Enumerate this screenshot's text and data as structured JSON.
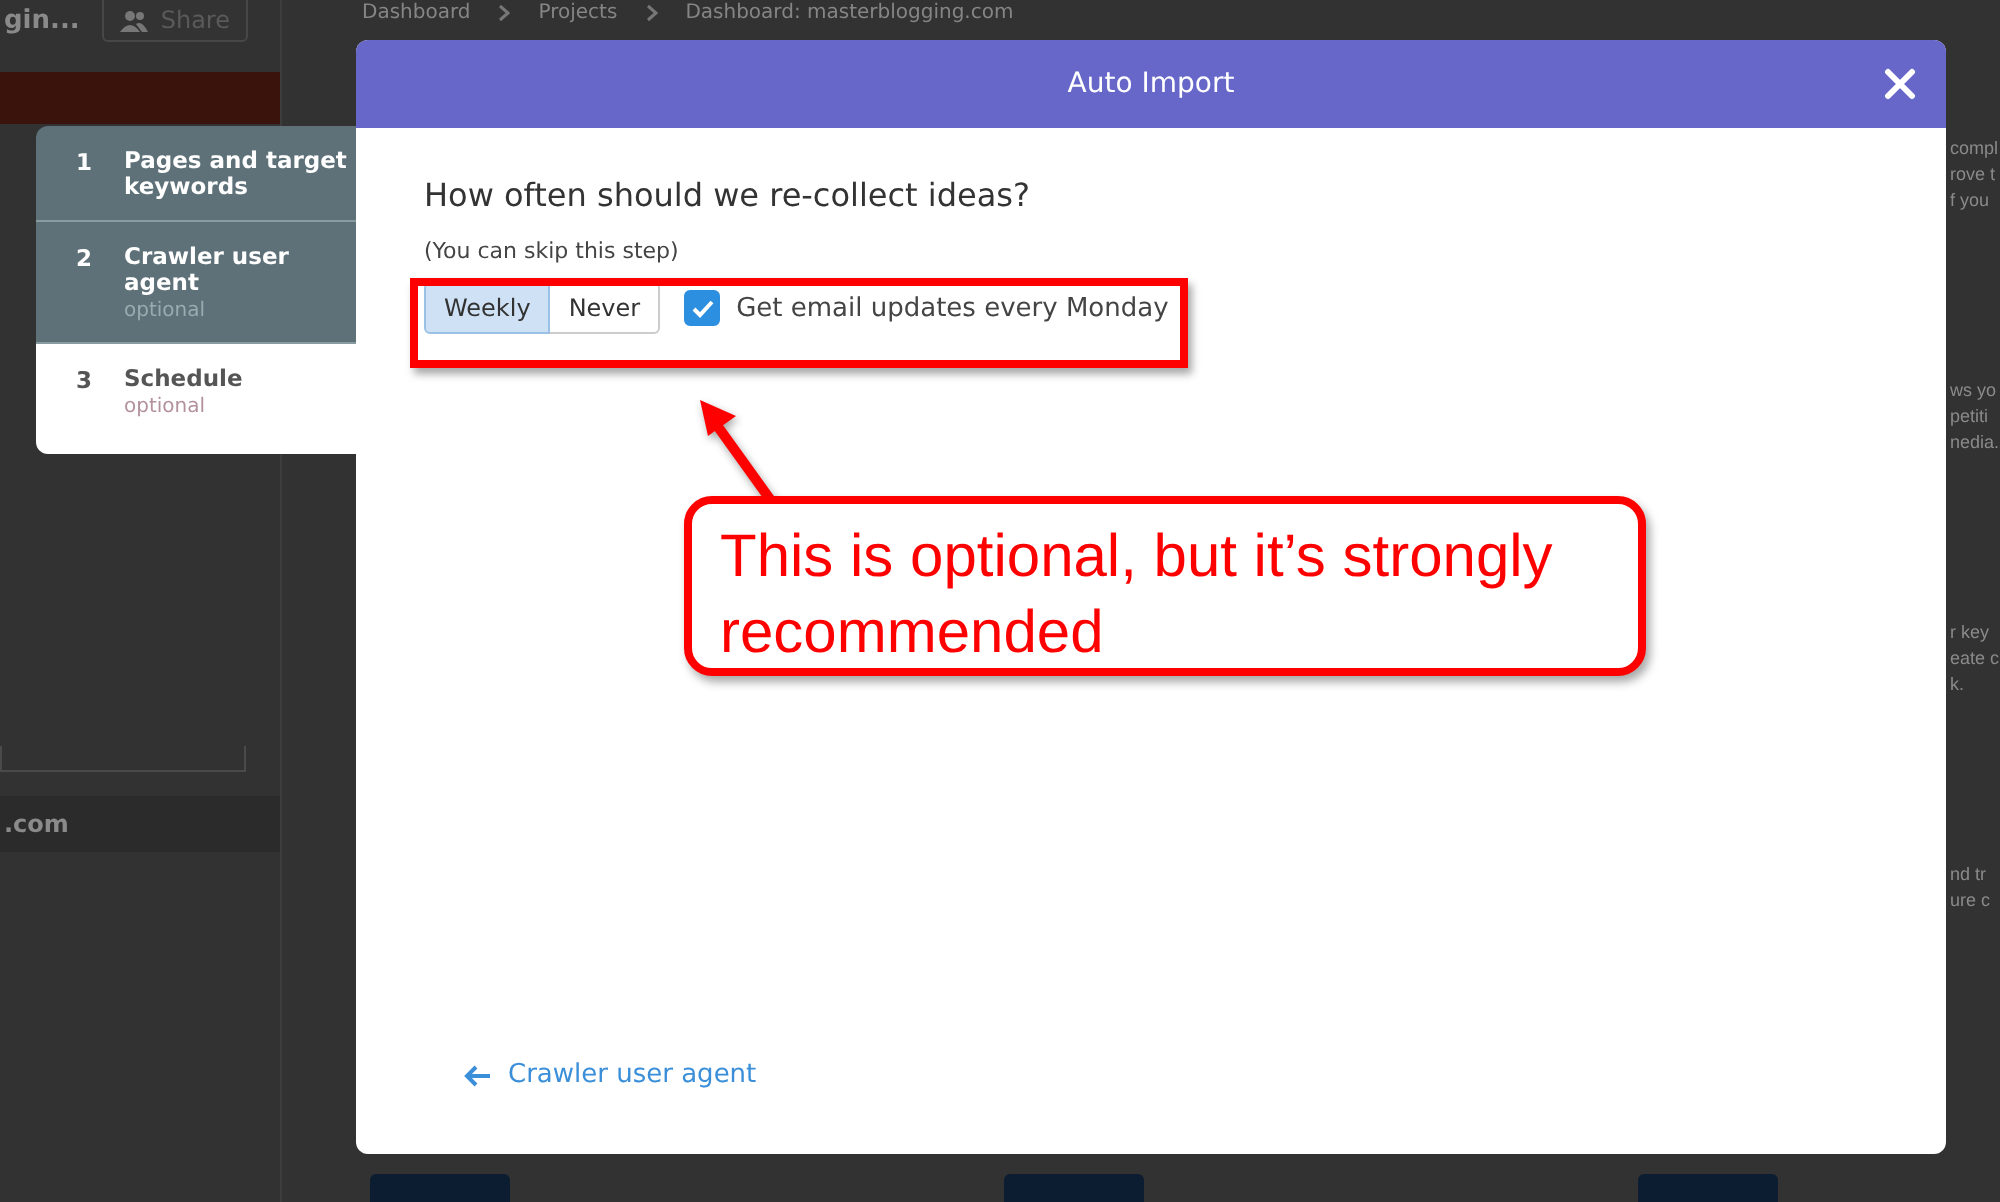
{
  "background": {
    "project_title": "gin...",
    "share_button": "Share",
    "breadcrumb": [
      "Dashboard",
      "Projects",
      "Dashboard: masterblogging.com"
    ],
    "sidebar_domain": ".com",
    "right_fragments": [
      [
        "compl",
        "rove t",
        "f you"
      ],
      [
        "ws yo",
        "petiti",
        "nedia."
      ],
      [
        "r key",
        "eate c",
        "k."
      ],
      [
        "nd tr",
        "ure c"
      ]
    ]
  },
  "steps": [
    {
      "number": "1",
      "label": "Pages and target keywords",
      "selected": false
    },
    {
      "number": "2",
      "label": "Crawler user agent",
      "note": "optional",
      "selected": false
    },
    {
      "number": "3",
      "label": "Schedule",
      "note": "optional",
      "selected": true
    }
  ],
  "dialog": {
    "title": "Auto Import",
    "question": "How often should we re-collect ideas?",
    "hint": "(You can skip this step)",
    "frequency": [
      {
        "label": "Weekly",
        "selected": true
      },
      {
        "label": "Never",
        "selected": false
      }
    ],
    "email_updates": {
      "label": "Get email updates every Monday",
      "checked": true
    },
    "back_link": "Crawler user agent"
  },
  "annotation": {
    "callout": "This is optional, but it’s strongly recommended"
  }
}
